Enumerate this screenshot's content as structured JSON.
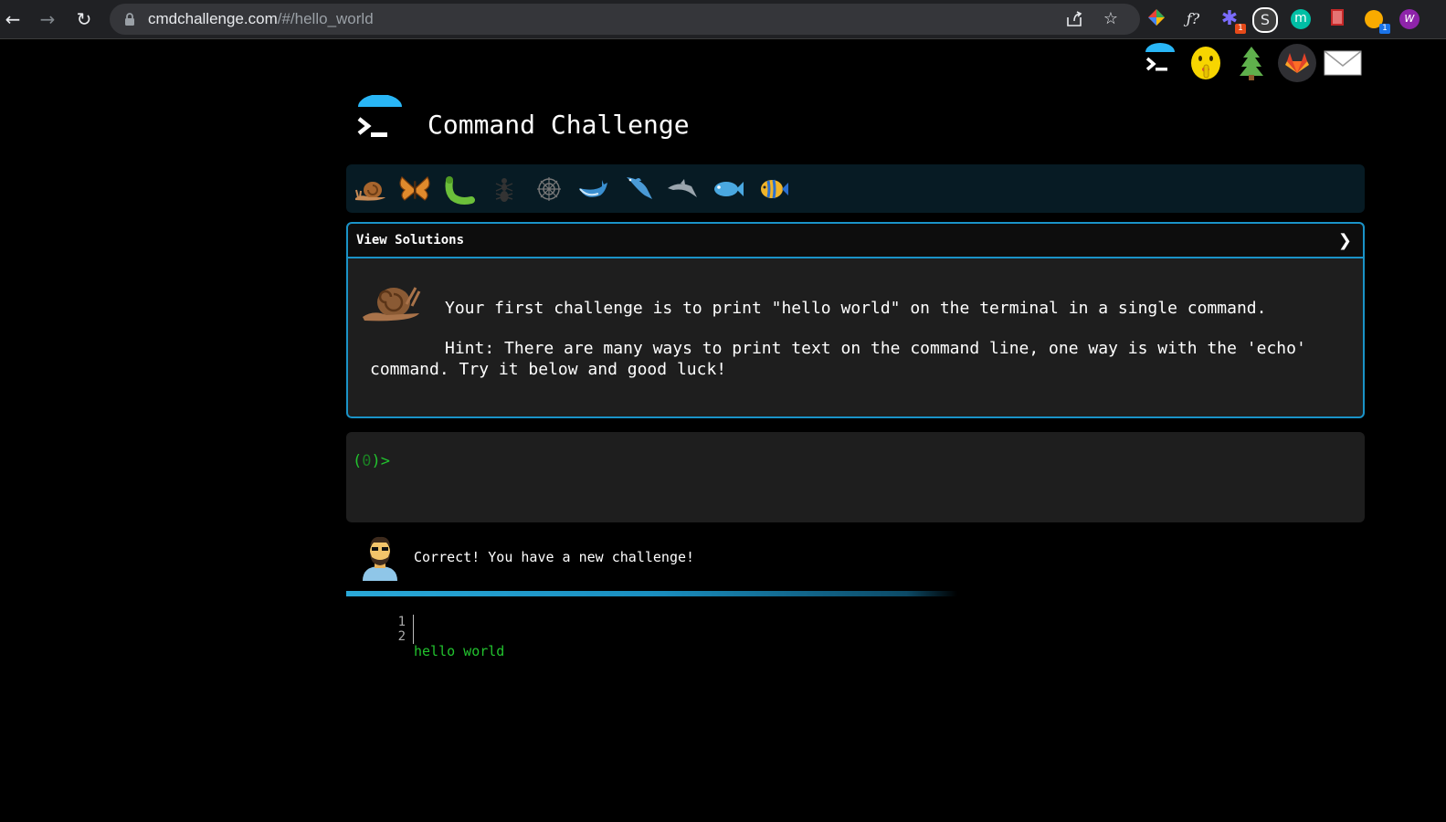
{
  "browser": {
    "url_host": "cmdchallenge.com",
    "url_path": "/#/hello_world",
    "icons": {
      "back": "back-arrow-icon",
      "forward": "forward-arrow-icon",
      "reload": "reload-icon",
      "lock": "lock-icon",
      "share": "share-icon",
      "star": "bookmark-star-icon"
    },
    "extensions": [
      {
        "name": "color-picker-extension-icon",
        "glyph": "◆",
        "color": "#e94235",
        "badge": ""
      },
      {
        "name": "formula-extension-icon",
        "glyph": "ƒ?",
        "color": "#e8eaed",
        "badge": ""
      },
      {
        "name": "sparkle-extension-icon",
        "glyph": "✱",
        "color": "#7b6cff",
        "badge": "1"
      },
      {
        "name": "s-extension-icon",
        "glyph": "S",
        "color": "#ffffff",
        "badge": ""
      },
      {
        "name": "m-extension-icon",
        "glyph": "m",
        "color": "#00bfa5",
        "badge": ""
      },
      {
        "name": "bookmark-extension-icon",
        "glyph": "▮",
        "color": "#c62828",
        "badge": ""
      },
      {
        "name": "honey-extension-icon",
        "glyph": "●",
        "color": "#f9ab00",
        "badge": "1"
      },
      {
        "name": "w-extension-icon",
        "glyph": "w",
        "color": "#8e24aa",
        "badge": ""
      }
    ]
  },
  "site_icons": [
    {
      "name": "terminal-logo-icon",
      "glyph": "",
      "color": "#ffffff"
    },
    {
      "name": "shushing-face-icon",
      "glyph": "🤫",
      "color": "#f7d500"
    },
    {
      "name": "tree-icon",
      "glyph": "🌲",
      "color": "#5fb04c"
    },
    {
      "name": "gitlab-icon",
      "glyph": "",
      "color": "#e24329"
    },
    {
      "name": "mail-icon",
      "glyph": "✉",
      "color": "#ffffff"
    }
  ],
  "header": {
    "title": "Command Challenge"
  },
  "animals": [
    {
      "name": "snail-icon",
      "glyph": "🐌",
      "color": "#b5733c"
    },
    {
      "name": "butterfly-icon",
      "glyph": "🦋",
      "color": "#e08a2c"
    },
    {
      "name": "caterpillar-icon",
      "glyph": "🐛",
      "color": "#6bbf3a"
    },
    {
      "name": "ant-icon",
      "glyph": "🐜",
      "color": "#2b2b2b"
    },
    {
      "name": "spider-web-icon",
      "glyph": "🕸",
      "color": "#666666"
    },
    {
      "name": "whale-icon",
      "glyph": "🐋",
      "color": "#3a8fd0"
    },
    {
      "name": "shark-icon",
      "glyph": "🦈",
      "color": "#4a9ad6"
    },
    {
      "name": "dolphin-icon",
      "glyph": "🐬",
      "color": "#9aa5ad"
    },
    {
      "name": "fish-icon",
      "glyph": "🐟",
      "color": "#4aa8e0"
    },
    {
      "name": "tropical-fish-icon",
      "glyph": "🐠",
      "color": "#f0b429"
    }
  ],
  "panel": {
    "title": "View Solutions",
    "chevron": "❯",
    "challenge": "Your first challenge is to print \"hello world\" on the terminal in a single command.",
    "hint": "Hint: There are many ways to print text on the command line, one way is with the 'echo' command. Try it below and good luck!"
  },
  "terminal": {
    "prompt_open": "(",
    "prompt_count": "0",
    "prompt_close": ")>"
  },
  "feedback": {
    "message": "Correct! You have a new challenge!"
  },
  "output": {
    "line_numbers": [
      "1",
      "2"
    ],
    "lines": [
      "hello world",
      ""
    ]
  },
  "colors": {
    "accent": "#1a93c8",
    "prompt_green": "#22c32e"
  }
}
